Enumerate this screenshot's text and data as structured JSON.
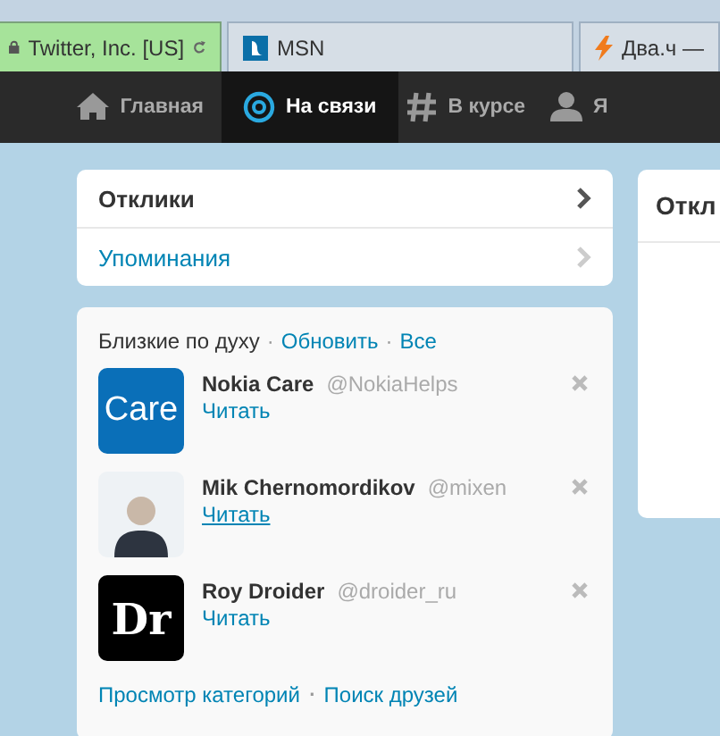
{
  "browser_tabs": [
    {
      "label": "Twitter, Inc. [US]",
      "kind": "secure",
      "selected": true
    },
    {
      "label": "MSN",
      "kind": "msn",
      "selected": false
    },
    {
      "label": "Два.ч —",
      "kind": "bolt",
      "selected": false
    }
  ],
  "nav": [
    {
      "label": "Главная",
      "kind": "home",
      "selected": false
    },
    {
      "label": "На связи",
      "kind": "at",
      "selected": true
    },
    {
      "label": "В курсе",
      "kind": "hash",
      "selected": false
    },
    {
      "label": "Я",
      "kind": "person",
      "selected": false
    }
  ],
  "menu": [
    {
      "label": "Отклики",
      "selected": true
    },
    {
      "label": "Упоминания",
      "selected": false
    }
  ],
  "right_panel": {
    "title": "Откл"
  },
  "who_to_follow": {
    "title": "Близкие по духу",
    "separator": "·",
    "links": [
      "Обновить",
      "Все"
    ],
    "users": [
      {
        "name": "Nokia Care",
        "handle": "@NokiaHelps",
        "action": "Читать",
        "kind": "logo",
        "avatar_text": "Care",
        "hovered": false
      },
      {
        "name": "Mik Chernomordikov",
        "handle": "@mixen",
        "action": "Читать",
        "kind": "photo",
        "hovered": true
      },
      {
        "name": "Roy Droider",
        "handle": "@droider_ru",
        "action": "Читать",
        "kind": "mark",
        "avatar_text": "Dr",
        "hovered": false
      }
    ],
    "footer_links": [
      "Просмотр категорий",
      "Поиск друзей"
    ],
    "footer_separator": "·"
  }
}
